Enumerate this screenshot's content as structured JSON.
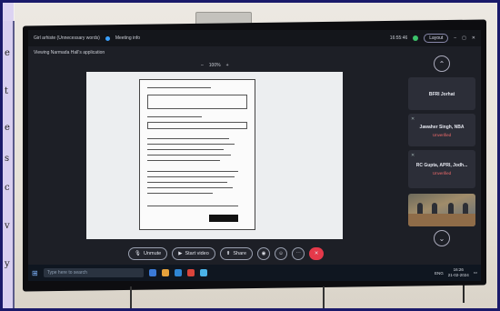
{
  "left_strip": {
    "chars": [
      "e",
      "t",
      "e",
      "s",
      "c",
      "v",
      "y"
    ]
  },
  "meeting": {
    "title": "Girl arhiste (Unnecessary words)",
    "info": "Meeting info",
    "time": "16:55:46",
    "layout": "Layout",
    "viewing": "Viewing Narmada Hall's application",
    "zoom": "100%"
  },
  "participants": [
    {
      "name": "BFRI Jorhat",
      "status": ""
    },
    {
      "name": "Jawaher Singh, NBA",
      "status": "Unverified"
    },
    {
      "name": "RC Gupta, APRI, Jodh...",
      "status": "Unverified"
    }
  ],
  "controls": {
    "unmute": "Unmute",
    "start_video": "Start video",
    "share": "Share"
  },
  "taskbar": {
    "search_placeholder": "Type here to search",
    "weather": "ENG",
    "time": "16:26",
    "date": "21-02-2024"
  }
}
